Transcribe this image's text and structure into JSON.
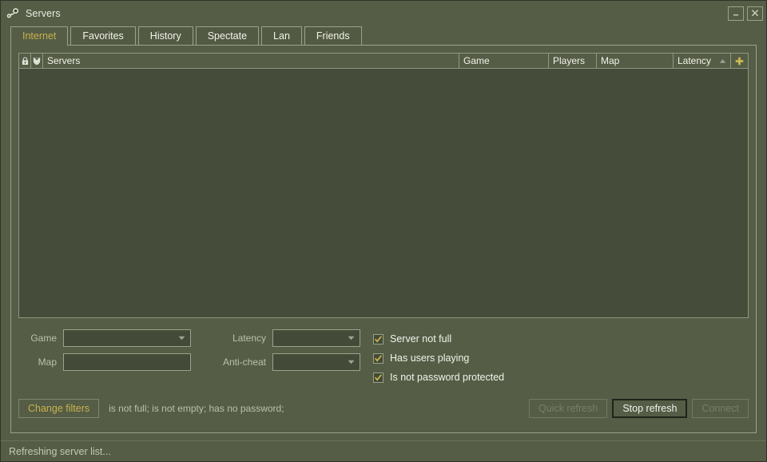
{
  "window": {
    "title": "Servers",
    "logo_icon": "steam-logo-icon",
    "minimize_label": "–",
    "close_label": "×"
  },
  "tabs": [
    {
      "label": "Internet",
      "active": true
    },
    {
      "label": "Favorites",
      "active": false
    },
    {
      "label": "History",
      "active": false
    },
    {
      "label": "Spectate",
      "active": false
    },
    {
      "label": "Lan",
      "active": false
    },
    {
      "label": "Friends",
      "active": false
    }
  ],
  "server_list": {
    "columns": [
      {
        "key": "lock",
        "label": "",
        "icon": "lock-icon"
      },
      {
        "key": "secure",
        "label": "",
        "icon": "shield-icon"
      },
      {
        "key": "servers",
        "label": "Servers",
        "icon": ""
      },
      {
        "key": "game",
        "label": "Game",
        "icon": ""
      },
      {
        "key": "players",
        "label": "Players",
        "icon": ""
      },
      {
        "key": "map",
        "label": "Map",
        "icon": ""
      },
      {
        "key": "latency",
        "label": "Latency",
        "icon": ""
      },
      {
        "key": "add",
        "label": "",
        "icon": "plus-icon"
      }
    ],
    "sort_column": "Latency",
    "sort_direction": "ascending",
    "sort_arrow": "▲",
    "rows": []
  },
  "filters": {
    "game": {
      "label": "Game",
      "value": "",
      "type": "dropdown"
    },
    "map": {
      "label": "Map",
      "value": "",
      "placeholder": "",
      "type": "text"
    },
    "latency": {
      "label": "Latency",
      "value": "",
      "type": "dropdown"
    },
    "anticheat": {
      "label": "Anti-cheat",
      "value": "",
      "type": "dropdown"
    },
    "checkboxes": [
      {
        "label": "Server not full",
        "checked": true
      },
      {
        "label": "Has users playing",
        "checked": true
      },
      {
        "label": "Is not password protected",
        "checked": true
      }
    ]
  },
  "actions": {
    "change_filters_label": "Change filters",
    "filter_summary": "is not full; is not empty; has no password;",
    "quick_refresh_label": "Quick refresh",
    "quick_refresh_enabled": false,
    "stop_refresh_label": "Stop refresh",
    "stop_refresh_enabled": true,
    "connect_label": "Connect",
    "connect_enabled": false
  },
  "status": {
    "text": "Refreshing server list..."
  },
  "colors": {
    "window_bg": "#555d46",
    "list_bg": "#454c39",
    "accent_gold": "#c8b24a",
    "border": "#9aa28c",
    "muted_text": "#b9c0ad",
    "disabled_text": "#787f68"
  }
}
